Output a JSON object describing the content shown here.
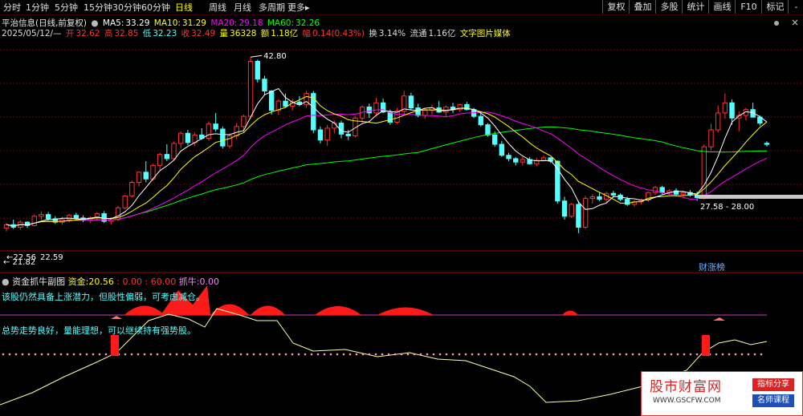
{
  "toolbar": {
    "periods": [
      "分时",
      "1分钟",
      "5分钟",
      "15分钟",
      "30分钟",
      "60分钟",
      "日线",
      "周线",
      "月线",
      "多周期",
      "更多▸"
    ],
    "active_period": "日线",
    "buttons": [
      "复权",
      "叠加",
      "多股",
      "统计",
      "画线",
      "F10",
      "标记",
      "-"
    ]
  },
  "header": {
    "stock_title": "平治信息(日线,前复权)",
    "ma5_label": "MA5:",
    "ma5": "33.29",
    "ma10_label": "MA10:",
    "ma10": "31.29",
    "ma20_label": "MA20:",
    "ma20": "29.18",
    "ma60_label": "MA60:",
    "ma60": "32.26"
  },
  "quote": {
    "date": "2025/05/12/—",
    "open_label": "开",
    "open": "32.62",
    "high_label": "高",
    "high": "32.85",
    "low_label": "低",
    "low": "32.23",
    "close_label": "收",
    "close": "32.49",
    "vol_label": "量",
    "vol": "36328",
    "amount_label": "额",
    "amount": "1.18亿",
    "chg_label": "幅",
    "chg": "0.14(0.43%)",
    "turnover_label": "换",
    "turnover": "3.14%",
    "float_label": "流通",
    "float": "1.16亿",
    "extra": "文字图片媒体"
  },
  "annotations": {
    "high_marker": "42.80",
    "low_marker_left": "22.56",
    "low_marker_right": "22.59",
    "low_marker_bottom": "21.82",
    "range_label": "27.58 - 28.00",
    "badge": "财涨榜"
  },
  "indicator": {
    "name": "资金抓牛副图",
    "fund_label": "资金:",
    "fund": "20.56",
    "v1": ": 0.00",
    "v2": ": 60.00",
    "bull_label": "抓牛:",
    "bull": "0.00",
    "comment1": "该股仍然具备上涨潜力，但股性偏弱，可考虑减仓。",
    "comment2": "总势走势良好，量能理想，可以继续持有强势股。"
  },
  "watermark": {
    "title": "股市财富网",
    "url": "WWW.GSCFW.COM",
    "tag1": "指标分享",
    "tag2": "名师课程"
  },
  "colors": {
    "up": "#ff3232",
    "down": "#54ffff",
    "ma5": "#ffffff",
    "ma10": "#ffff00",
    "ma20": "#ff00ff",
    "ma60": "#00ff00",
    "grid": "#7a0000"
  },
  "chart_data": {
    "type": "candlestick",
    "ylim": [
      20,
      45
    ],
    "candles": [
      [
        22.6,
        23.2,
        22.2,
        23.0
      ],
      [
        23.0,
        23.6,
        22.5,
        22.7
      ],
      [
        22.7,
        23.5,
        22.4,
        23.3
      ],
      [
        23.3,
        23.4,
        22.6,
        22.9
      ],
      [
        22.9,
        24.2,
        22.8,
        24.0
      ],
      [
        24.0,
        24.6,
        23.6,
        24.2
      ],
      [
        24.2,
        24.5,
        23.5,
        23.7
      ],
      [
        23.7,
        24.0,
        23.1,
        23.3
      ],
      [
        23.3,
        23.9,
        23.0,
        23.6
      ],
      [
        23.6,
        24.3,
        23.3,
        24.1
      ],
      [
        24.1,
        24.4,
        23.5,
        23.8
      ],
      [
        23.8,
        24.1,
        23.3,
        23.5
      ],
      [
        23.5,
        24.0,
        23.2,
        23.8
      ],
      [
        23.8,
        24.5,
        23.5,
        24.3
      ],
      [
        24.3,
        24.6,
        23.2,
        23.4
      ],
      [
        23.4,
        23.9,
        23.0,
        23.6
      ],
      [
        23.6,
        25.2,
        23.4,
        25.0
      ],
      [
        25.0,
        26.5,
        24.8,
        26.4
      ],
      [
        26.4,
        28.2,
        26.2,
        28.0
      ],
      [
        28.0,
        29.3,
        27.5,
        29.2
      ],
      [
        29.2,
        30.5,
        28.0,
        28.4
      ],
      [
        28.4,
        30.2,
        28.2,
        30.0
      ],
      [
        30.0,
        31.5,
        29.5,
        31.3
      ],
      [
        31.3,
        32.5,
        30.5,
        30.8
      ],
      [
        30.8,
        32.8,
        30.6,
        32.6
      ],
      [
        32.6,
        34.0,
        32.0,
        33.8
      ],
      [
        33.8,
        34.2,
        32.4,
        32.7
      ],
      [
        32.7,
        33.9,
        32.3,
        33.6
      ],
      [
        33.6,
        34.4,
        33.0,
        33.2
      ],
      [
        33.2,
        35.2,
        32.9,
        34.9
      ],
      [
        34.9,
        36.2,
        34.0,
        34.3
      ],
      [
        34.3,
        34.6,
        32.0,
        32.3
      ],
      [
        32.3,
        33.8,
        32.0,
        33.5
      ],
      [
        33.5,
        35.0,
        33.1,
        34.6
      ],
      [
        34.6,
        36.0,
        34.0,
        35.8
      ],
      [
        35.8,
        42.8,
        35.5,
        42.3
      ],
      [
        42.3,
        42.5,
        39.8,
        40.2
      ],
      [
        40.2,
        40.6,
        38.3,
        38.8
      ],
      [
        38.8,
        38.9,
        36.0,
        36.5
      ],
      [
        36.5,
        37.8,
        36.0,
        37.6
      ],
      [
        37.6,
        38.5,
        36.8,
        37.0
      ],
      [
        37.0,
        37.9,
        36.5,
        37.5
      ],
      [
        37.5,
        38.2,
        37.0,
        37.2
      ],
      [
        37.2,
        38.8,
        36.8,
        38.5
      ],
      [
        38.5,
        38.8,
        33.8,
        34.2
      ],
      [
        34.2,
        34.6,
        32.6,
        33.0
      ],
      [
        33.0,
        34.8,
        32.3,
        34.4
      ],
      [
        34.4,
        35.3,
        33.8,
        35.0
      ],
      [
        35.0,
        35.3,
        33.2,
        33.7
      ],
      [
        33.7,
        34.2,
        33.0,
        33.5
      ],
      [
        33.5,
        35.8,
        33.3,
        35.6
      ],
      [
        35.6,
        37.1,
        35.0,
        36.9
      ],
      [
        36.9,
        37.3,
        35.6,
        36.2
      ],
      [
        36.2,
        38.0,
        35.8,
        37.4
      ],
      [
        37.4,
        37.9,
        36.2,
        36.3
      ],
      [
        36.3,
        36.6,
        34.8,
        35.1
      ],
      [
        35.1,
        36.8,
        34.9,
        36.4
      ],
      [
        36.4,
        38.8,
        35.9,
        38.2
      ],
      [
        38.2,
        38.6,
        36.5,
        36.8
      ],
      [
        36.8,
        37.3,
        35.7,
        35.9
      ],
      [
        35.9,
        36.8,
        35.5,
        36.5
      ],
      [
        36.5,
        37.2,
        36.0,
        36.8
      ],
      [
        36.8,
        37.6,
        36.2,
        36.3
      ],
      [
        36.3,
        37.1,
        35.7,
        36.9
      ],
      [
        36.9,
        37.4,
        36.2,
        36.6
      ],
      [
        36.6,
        37.3,
        36.3,
        37.2
      ],
      [
        37.2,
        37.5,
        36.5,
        36.6
      ],
      [
        36.6,
        36.8,
        35.6,
        35.8
      ],
      [
        35.8,
        36.2,
        34.6,
        34.8
      ],
      [
        34.8,
        35.0,
        33.4,
        33.6
      ],
      [
        33.6,
        34.0,
        32.2,
        32.5
      ],
      [
        32.5,
        32.9,
        31.0,
        31.2
      ],
      [
        31.2,
        31.5,
        30.5,
        30.8
      ],
      [
        30.8,
        31.0,
        30.0,
        30.4
      ],
      [
        30.4,
        31.0,
        30.0,
        30.7
      ],
      [
        30.7,
        31.0,
        30.1,
        30.2
      ],
      [
        30.2,
        30.9,
        29.9,
        30.6
      ],
      [
        30.6,
        31.2,
        30.4,
        30.9
      ],
      [
        30.9,
        31.0,
        30.3,
        30.5
      ],
      [
        30.5,
        30.6,
        25.5,
        25.8
      ],
      [
        25.8,
        26.3,
        23.6,
        24.0
      ],
      [
        24.0,
        25.6,
        23.8,
        25.4
      ],
      [
        25.4,
        25.8,
        22.0,
        22.7
      ],
      [
        22.7,
        26.4,
        22.5,
        26.1
      ],
      [
        26.1,
        26.6,
        25.5,
        26.3
      ],
      [
        26.3,
        26.8,
        25.8,
        26.0
      ],
      [
        26.0,
        26.9,
        25.6,
        26.7
      ],
      [
        26.7,
        27.0,
        26.2,
        26.5
      ],
      [
        26.5,
        26.7,
        25.8,
        26.0
      ],
      [
        26.0,
        26.3,
        25.2,
        25.4
      ],
      [
        25.4,
        25.9,
        25.1,
        25.7
      ],
      [
        25.7,
        26.1,
        25.4,
        25.9
      ],
      [
        25.9,
        26.9,
        25.7,
        26.8
      ],
      [
        26.8,
        27.6,
        26.5,
        27.4
      ],
      [
        27.4,
        27.6,
        26.6,
        26.8
      ],
      [
        26.8,
        27.2,
        26.5,
        27.0
      ],
      [
        27.0,
        27.3,
        26.4,
        26.6
      ],
      [
        26.6,
        27.0,
        26.3,
        26.8
      ],
      [
        26.8,
        27.1,
        26.3,
        26.5
      ],
      [
        26.5,
        26.9,
        25.8,
        26.2
      ],
      [
        26.2,
        32.5,
        26.0,
        32.2
      ],
      [
        32.2,
        34.9,
        31.8,
        34.2
      ],
      [
        34.2,
        37.1,
        33.9,
        36.2
      ],
      [
        36.2,
        38.5,
        35.5,
        37.4
      ],
      [
        37.4,
        37.8,
        34.8,
        35.6
      ],
      [
        35.6,
        36.4,
        34.0,
        35.9
      ],
      [
        35.9,
        36.8,
        35.3,
        36.6
      ],
      [
        36.6,
        37.4,
        35.8,
        35.7
      ],
      [
        35.7,
        35.9,
        34.7,
        35.0
      ],
      [
        32.62,
        32.85,
        32.23,
        32.49
      ]
    ]
  }
}
